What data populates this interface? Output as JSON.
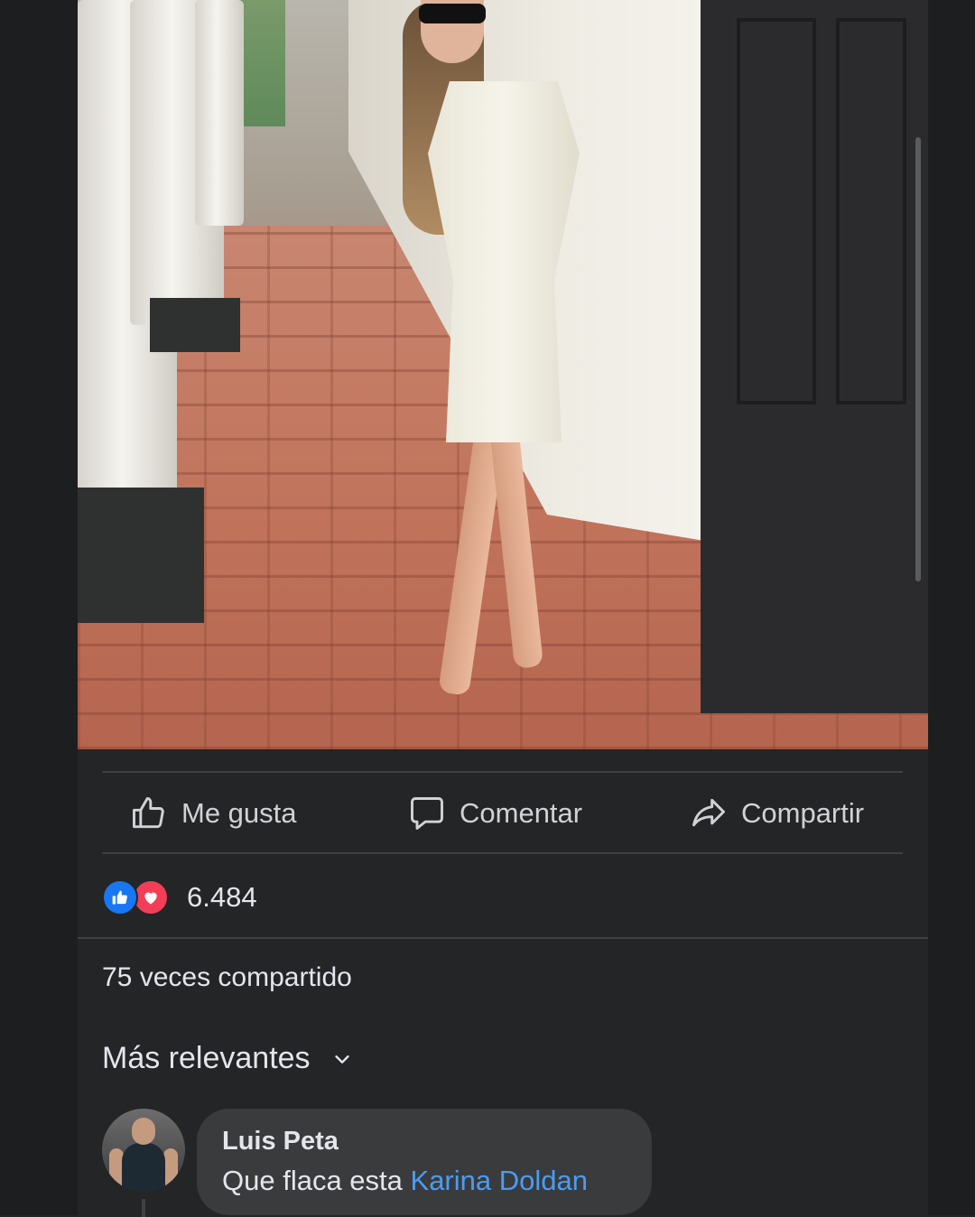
{
  "post": {
    "image_alt": "Mujer con vestido blanco y gafas de sol en un corredor con columnas",
    "actions": {
      "like_label": "Me gusta",
      "comment_label": "Comentar",
      "share_label": "Compartir"
    },
    "reactions": {
      "types": [
        "like",
        "love"
      ],
      "count": "6.484"
    },
    "shares_text": "75 veces compartido"
  },
  "comments": {
    "sort_label": "Más relevantes",
    "items": [
      {
        "author": "Luis Peta",
        "text": "Que flaca esta ",
        "mention": "Karina Doldan"
      }
    ]
  },
  "colors": {
    "background": "#242526",
    "text": "#e4e6eb",
    "like_blue": "#1877f2",
    "love_red": "#f33e58",
    "mention_blue": "#4a9cf5",
    "bubble": "#3a3b3c"
  }
}
